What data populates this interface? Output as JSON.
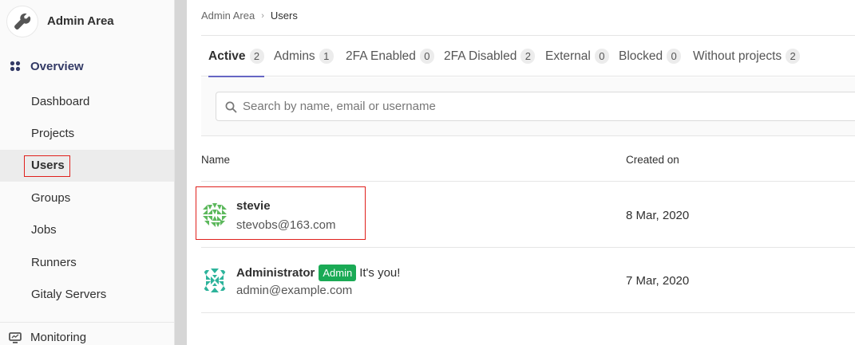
{
  "sidebar": {
    "context_title": "Admin Area",
    "context_icon": "wrench-icon",
    "overview_label": "Overview",
    "overview_icon": "overview-grid-icon",
    "items": [
      {
        "label": "Dashboard"
      },
      {
        "label": "Projects"
      },
      {
        "label": "Users"
      },
      {
        "label": "Groups"
      },
      {
        "label": "Jobs"
      },
      {
        "label": "Runners"
      },
      {
        "label": "Gitaly Servers"
      }
    ],
    "active_item": "Users",
    "monitoring_label": "Monitoring",
    "monitoring_icon": "monitor-icon"
  },
  "breadcrumb": {
    "parent": "Admin Area",
    "current": "Users"
  },
  "tabs": [
    {
      "label": "Active",
      "count": "2"
    },
    {
      "label": "Admins",
      "count": "1"
    },
    {
      "label": "2FA Enabled",
      "count": "0"
    },
    {
      "label": "2FA Disabled",
      "count": "2"
    },
    {
      "label": "External",
      "count": "0"
    },
    {
      "label": "Blocked",
      "count": "0"
    },
    {
      "label": "Without projects",
      "count": "2"
    }
  ],
  "active_tab": "Active",
  "search": {
    "placeholder": "Search by name, email or username",
    "value": ""
  },
  "table": {
    "headers": {
      "name": "Name",
      "created": "Created on"
    },
    "rows": [
      {
        "name": "stevie",
        "email": "stevobs@163.com",
        "created": "8 Mar, 2020",
        "badge": "",
        "note": ""
      },
      {
        "name": "Administrator",
        "email": "admin@example.com",
        "created": "7 Mar, 2020",
        "badge": "Admin",
        "note": "It's you!"
      }
    ]
  },
  "colors": {
    "accent": "#6666c4",
    "admin_badge": "#1aaa55",
    "highlight": "#e0201c",
    "stevie_avatar": "#5cb85c",
    "admin_avatar": "#2db39b"
  }
}
